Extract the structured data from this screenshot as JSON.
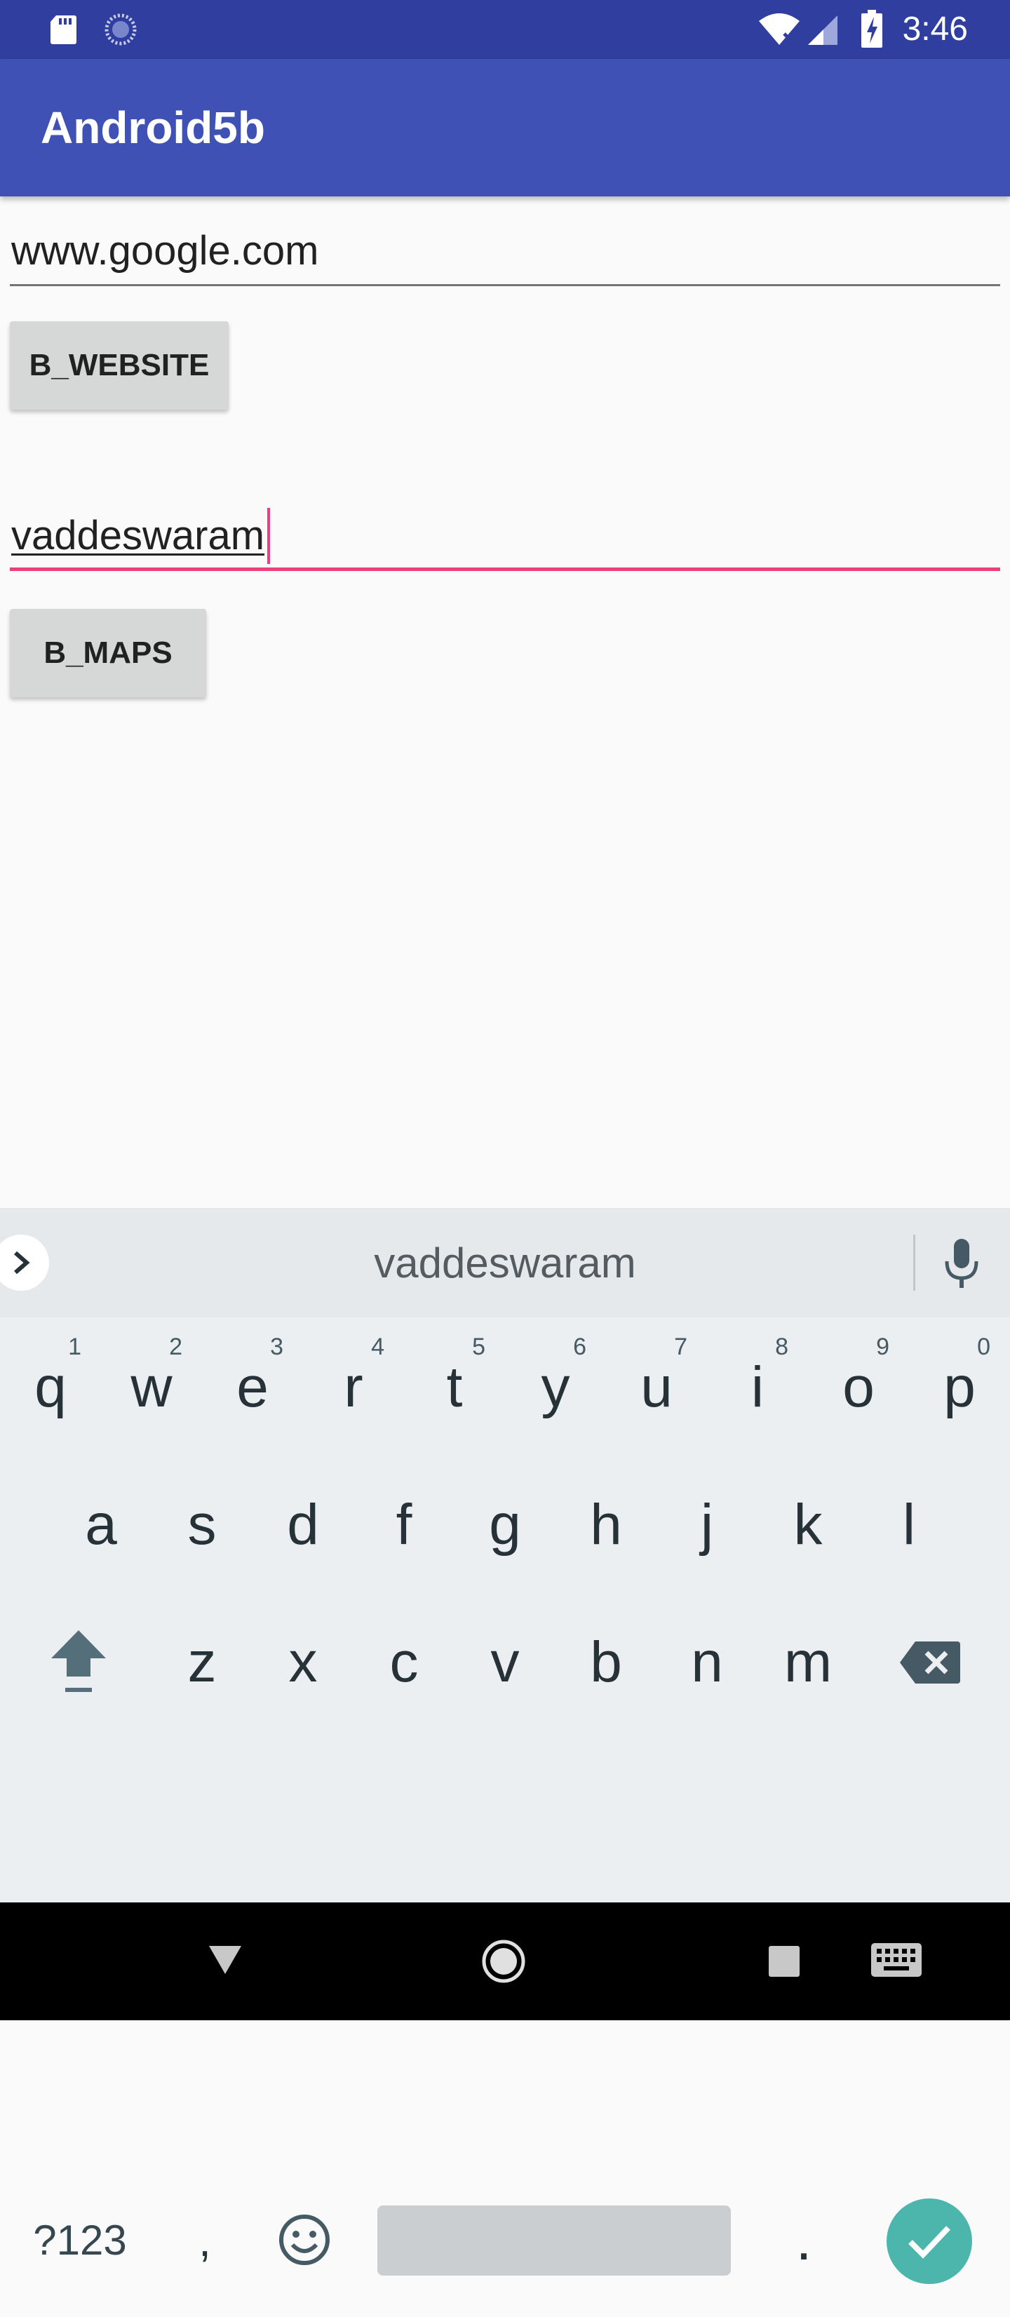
{
  "status_bar": {
    "time": "3:46",
    "icons": [
      "sd-card-icon",
      "sync-icon",
      "wifi-icon",
      "signal-icon",
      "battery-charging-icon"
    ]
  },
  "app_bar": {
    "title": "Android5b",
    "color": "#3f51b5"
  },
  "form": {
    "url_field": {
      "value": "www.google.com"
    },
    "website_button": {
      "label": "B_WEBSITE"
    },
    "maps_field": {
      "value": "vaddeswaram",
      "focused": true,
      "accent": "#ec407a"
    },
    "maps_button": {
      "label": "B_MAPS"
    }
  },
  "keyboard": {
    "suggestion": "vaddeswaram",
    "row1": [
      {
        "k": "q",
        "h": "1"
      },
      {
        "k": "w",
        "h": "2"
      },
      {
        "k": "e",
        "h": "3"
      },
      {
        "k": "r",
        "h": "4"
      },
      {
        "k": "t",
        "h": "5"
      },
      {
        "k": "y",
        "h": "6"
      },
      {
        "k": "u",
        "h": "7"
      },
      {
        "k": "i",
        "h": "8"
      },
      {
        "k": "o",
        "h": "9"
      },
      {
        "k": "p",
        "h": "0"
      }
    ],
    "row2": [
      "a",
      "s",
      "d",
      "f",
      "g",
      "h",
      "j",
      "k",
      "l"
    ],
    "row3": [
      "z",
      "x",
      "c",
      "v",
      "b",
      "n",
      "m"
    ],
    "symbols_key": "?123",
    "comma_key": ",",
    "period_key": ".",
    "done_color": "#4db6ac"
  },
  "nav_bar": {
    "icons": [
      "back-icon",
      "home-icon",
      "recents-icon",
      "keyboard-switch-icon"
    ]
  }
}
